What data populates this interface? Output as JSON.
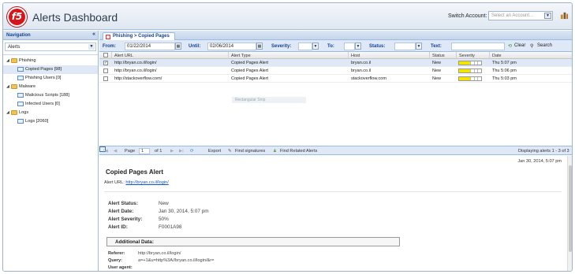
{
  "app": {
    "title": "Alerts Dashboard",
    "logo_text": "f5"
  },
  "account": {
    "label": "Switch Account:",
    "placeholder": "Select an Account..."
  },
  "nav": {
    "title": "Navigation",
    "collapse": "«",
    "combo": "Alerts",
    "tree": [
      {
        "label": "Phishing",
        "level": 0,
        "type": "folder"
      },
      {
        "label": "Copied Pages [98]",
        "level": 1,
        "type": "leaf",
        "selected": true
      },
      {
        "label": "Phishing Users [0]",
        "level": 1,
        "type": "leaf"
      },
      {
        "label": "Malware",
        "level": 0,
        "type": "folder"
      },
      {
        "label": "Malicious Scripts [188]",
        "level": 1,
        "type": "leaf"
      },
      {
        "label": "Infected Users [0]",
        "level": 1,
        "type": "leaf"
      },
      {
        "label": "Logs",
        "level": 0,
        "type": "folder"
      },
      {
        "label": "Logs [2060]",
        "level": 1,
        "type": "leaf"
      }
    ]
  },
  "tab": {
    "label": "Phishing > Copied Pages"
  },
  "filters": {
    "from_label": "From:",
    "from_value": "01/22/2014",
    "until_label": "Until:",
    "until_value": "02/06/2014",
    "severity_label": "Severity:",
    "to_label": "To:",
    "status_label": "Status:",
    "text_label": "Text:",
    "clear_label": "Clear",
    "search_label": "Search"
  },
  "grid": {
    "columns": [
      "Alert URL",
      "Alert Type",
      "Host",
      "Status",
      "Severity",
      "Date"
    ],
    "rows": [
      {
        "url": "http://bryan.co.il/login/",
        "type": "Copied Pages Alert",
        "host": "bryan.co.il",
        "status": "New",
        "severity": 0.5,
        "date": "Thu 5:07 pm",
        "selected": true
      },
      {
        "url": "http://bryan.co.il/login/",
        "type": "Copied Pages Alert",
        "host": "bryan.co.il",
        "status": "New",
        "severity": 0.5,
        "date": "Thu 5:06 pm",
        "selected": false
      },
      {
        "url": "http://stackoverflow.com/",
        "type": "Copied Pages Alert",
        "host": "stackoverflow.com",
        "status": "New",
        "severity": 0.5,
        "date": "Thu 5:03 pm",
        "selected": false
      }
    ],
    "drag_hint": "Rectangular Snip"
  },
  "pager": {
    "page_label": "Page",
    "page_value": "1",
    "of_label": "of 1",
    "export_label": "Export",
    "find_signatures_label": "Find signatures",
    "find_related_label": "Find Related Alerts",
    "display_text": "Displaying alerts 1 - 3 of 3"
  },
  "detail": {
    "timestamp": "Jan 30, 2014, 5:07 pm",
    "title": "Copied Pages Alert",
    "url_label": "Alert URL:",
    "url_value": "http://bryan.co.il/login/",
    "status_label": "Alert Status:",
    "status_value": "New",
    "date_label": "Alert Date:",
    "date_value": "Jan 30, 2014, 5:07 pm",
    "severity_label": "Alert Severity:",
    "severity_value": "50%",
    "id_label": "Alert ID:",
    "id_value": "F0001A98",
    "additional_label": "Additional Data:",
    "referer_label": "Referer:",
    "referer_value": "http://bryan.co.il/login/",
    "query_label": "Query:",
    "query_value": "a=+1&u=http%3A//bryan.co.il/login/&r=",
    "useragent_label": "User agent:"
  },
  "colors": {
    "accent": "#15428b",
    "header_bg": "#dfe8f6",
    "severity_fill": "#f5e400",
    "logo": "#d7141a"
  }
}
